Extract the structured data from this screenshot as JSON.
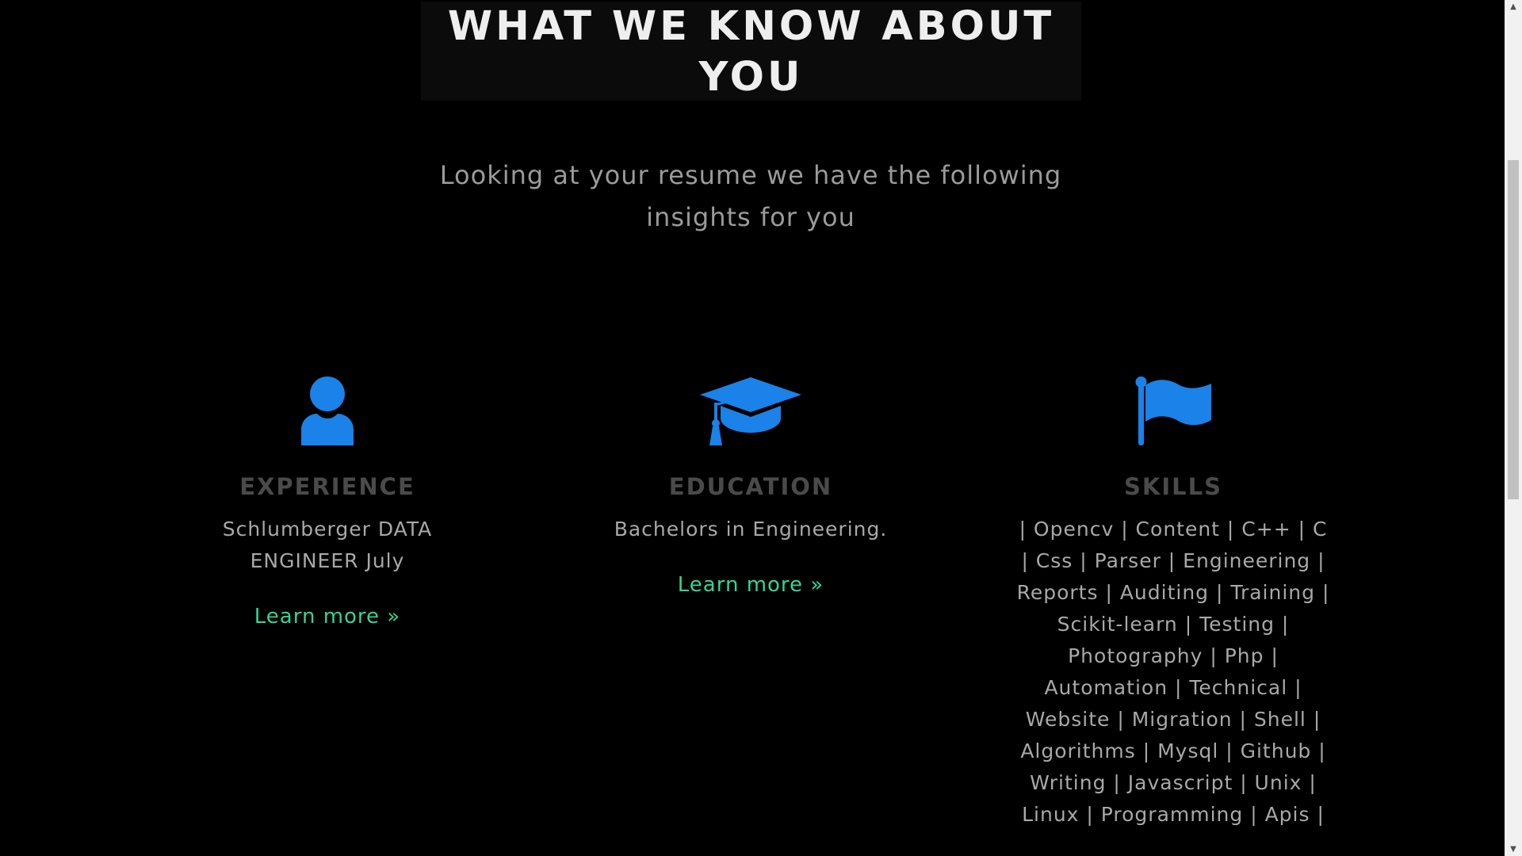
{
  "section": {
    "title": "WHAT WE KNOW ABOUT YOU",
    "subtitle": "Looking at your resume we have the following insights for you"
  },
  "colors": {
    "background": "#000000",
    "icon_blue": "#1a82e8",
    "link_green": "#34d399",
    "heading_gray": "#4a4a4a",
    "text_gray": "#a8a8a8"
  },
  "columns": [
    {
      "icon": "user-icon",
      "heading": "EXPERIENCE",
      "text": "Schlumberger DATA ENGINEER July",
      "link": "Learn more »"
    },
    {
      "icon": "graduation-cap-icon",
      "heading": "EDUCATION",
      "text": "Bachelors in Engineering.",
      "link": "Learn more »"
    },
    {
      "icon": "flag-icon",
      "heading": "SKILLS",
      "text": "| Opencv | Content | C++ | C | Css | Parser | Engineering | Reports | Auditing | Training | Scikit-learn | Testing | Photography | Php | Automation | Technical | Website | Migration | Shell | Algorithms | Mysql | Github | Writing | Javascript | Unix | Linux | Programming | Apis |"
    }
  ]
}
